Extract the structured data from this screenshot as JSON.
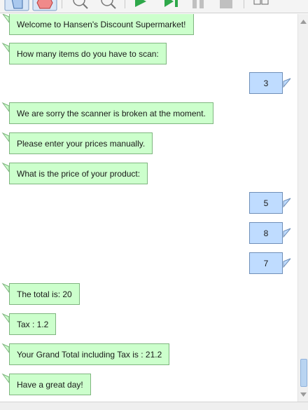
{
  "toolbar": {
    "icons": [
      "pointer-icon",
      "stop-icon",
      "zoom-in-icon",
      "zoom-out-icon",
      "play-icon",
      "step-icon",
      "pause-icon",
      "stop-square-icon",
      "layout-icon"
    ]
  },
  "colors": {
    "bot_bubble": "#ccffcc",
    "bot_border": "#7fb57f",
    "user_bubble": "#bfdcff",
    "user_border": "#6f8fb8"
  },
  "chat": {
    "messages": [
      {
        "from": "bot",
        "text": "Welcome to Hansen's Discount Supermarket!"
      },
      {
        "from": "bot",
        "text": "How many items do you have to scan:"
      },
      {
        "from": "user",
        "text": "3"
      },
      {
        "from": "bot",
        "text": "We are sorry the scanner is broken at the moment."
      },
      {
        "from": "bot",
        "text": "Please enter your prices manually."
      },
      {
        "from": "bot",
        "text": "What is the price of your product:"
      },
      {
        "from": "user",
        "text": "5"
      },
      {
        "from": "user",
        "text": "8"
      },
      {
        "from": "user",
        "text": "7"
      },
      {
        "from": "bot",
        "text": "The total  is: 20"
      },
      {
        "from": "bot",
        "text": "Tax : 1.2"
      },
      {
        "from": "bot",
        "text": "Your Grand Total including Tax is : 21.2"
      },
      {
        "from": "bot",
        "text": "Have a great day!"
      }
    ]
  }
}
